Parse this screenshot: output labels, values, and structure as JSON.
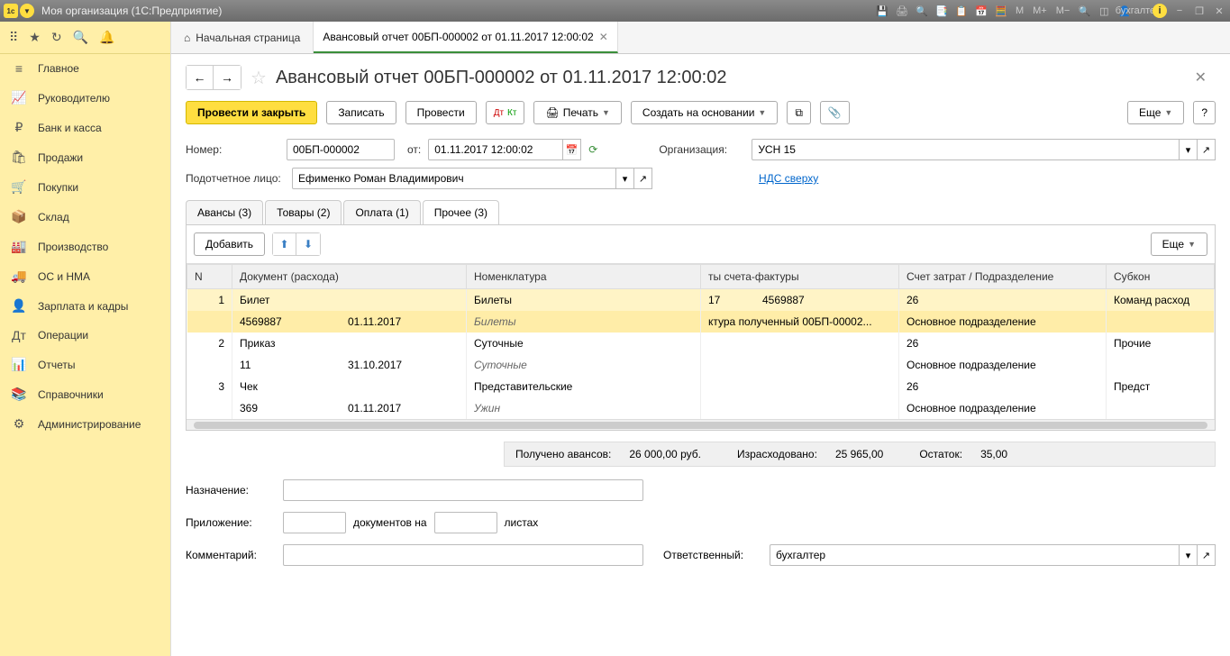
{
  "titlebar": {
    "title": "Моя организация  (1С:Предприятие)",
    "user": "бухгалтер",
    "m": "M",
    "mplus": "M+",
    "mminus": "M−"
  },
  "nav": {
    "items": [
      {
        "icon": "≡",
        "label": "Главное"
      },
      {
        "icon": "📈",
        "label": "Руководителю"
      },
      {
        "icon": "₽",
        "label": "Банк и касса"
      },
      {
        "icon": "🛍",
        "label": "Продажи"
      },
      {
        "icon": "🛒",
        "label": "Покупки"
      },
      {
        "icon": "📦",
        "label": "Склад"
      },
      {
        "icon": "🏭",
        "label": "Производство"
      },
      {
        "icon": "🚚",
        "label": "ОС и НМА"
      },
      {
        "icon": "👤",
        "label": "Зарплата и кадры"
      },
      {
        "icon": "Дт",
        "label": "Операции"
      },
      {
        "icon": "📊",
        "label": "Отчеты"
      },
      {
        "icon": "📚",
        "label": "Справочники"
      },
      {
        "icon": "⚙",
        "label": "Администрирование"
      }
    ]
  },
  "tabs": {
    "home": "Начальная страница",
    "doc": "Авансовый отчет 00БП-000002 от 01.11.2017 12:00:02"
  },
  "doc": {
    "title": "Авансовый отчет 00БП-000002 от 01.11.2017 12:00:02"
  },
  "toolbar": {
    "primary": "Провести и закрыть",
    "write": "Записать",
    "post": "Провести",
    "print": "Печать",
    "createBased": "Создать на основании",
    "more": "Еще"
  },
  "form": {
    "numberLabel": "Номер:",
    "number": "00БП-000002",
    "dateLabel": "от:",
    "date": "01.11.2017 12:00:02",
    "orgLabel": "Организация:",
    "org": "УСН 15",
    "personLabel": "Подотчетное лицо:",
    "person": "Ефименко Роман Владимирович",
    "vatLink": "НДС сверху"
  },
  "innerTabs": [
    "Авансы (3)",
    "Товары (2)",
    "Оплата (1)",
    "Прочее (3)"
  ],
  "tableToolbar": {
    "add": "Добавить",
    "more": "Еще"
  },
  "tableHead": [
    "N",
    "Документ (расхода)",
    "Номенклатура",
    "ты счета-фактуры",
    "Счет затрат / Подразделение",
    "Субкон"
  ],
  "rows": [
    {
      "n": "1",
      "doc1": "Билет",
      "doc2": "4569887",
      "date": "01.11.2017",
      "nom1": "Билеты",
      "nom2": "Билеты",
      "sf1a": "17",
      "sf1b": "4569887",
      "sf2": "ктура полученный 00БП-00002...",
      "acc1": "26",
      "acc2": "Основное подразделение",
      "sub": "Команд расход"
    },
    {
      "n": "2",
      "doc1": "Приказ",
      "doc2": "11",
      "date": "31.10.2017",
      "nom1": "Суточные",
      "nom2": "Суточные",
      "sf1a": "",
      "sf1b": "",
      "sf2": "",
      "acc1": "26",
      "acc2": "Основное подразделение",
      "sub": "Прочие"
    },
    {
      "n": "3",
      "doc1": "Чек",
      "doc2": "369",
      "date": "01.11.2017",
      "nom1": "Представительские",
      "nom2": "Ужин",
      "sf1a": "",
      "sf1b": "",
      "sf2": "",
      "acc1": "26",
      "acc2": "Основное подразделение",
      "sub": "Предст"
    }
  ],
  "summary": {
    "advLabel": "Получено авансов:",
    "advVal": "26 000,00",
    "cur": "руб.",
    "spentLabel": "Израсходовано:",
    "spentVal": "25 965,00",
    "remLabel": "Остаток:",
    "remVal": "35,00"
  },
  "bottom": {
    "purposeLabel": "Назначение:",
    "attachLabel": "Приложение:",
    "attachMid": "документов на",
    "attachEnd": "листах",
    "commentLabel": "Комментарий:",
    "respLabel": "Ответственный:",
    "resp": "бухгалтер"
  }
}
